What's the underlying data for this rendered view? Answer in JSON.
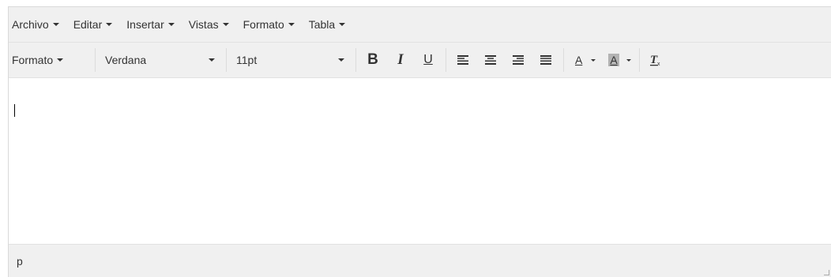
{
  "menubar": {
    "items": [
      {
        "label": "Archivo"
      },
      {
        "label": "Editar"
      },
      {
        "label": "Insertar"
      },
      {
        "label": "Vistas"
      },
      {
        "label": "Formato"
      },
      {
        "label": "Tabla"
      }
    ]
  },
  "toolbar": {
    "format_label": "Formato",
    "font_family": "Verdana",
    "font_size": "11pt",
    "bold_glyph": "B",
    "italic_glyph": "I",
    "underline_glyph": "U",
    "text_color_glyph": "A",
    "bg_color_glyph": "A",
    "icons": [
      "align-left-icon",
      "align-center-icon",
      "align-right-icon",
      "align-justify-icon",
      "clear-format-icon"
    ]
  },
  "statusbar": {
    "path": "p"
  },
  "colors": {
    "bar_bg": "#f0f0f0",
    "border": "#d9d9d9",
    "text": "#333333",
    "highlight_swatch": "#b3b3b3"
  }
}
